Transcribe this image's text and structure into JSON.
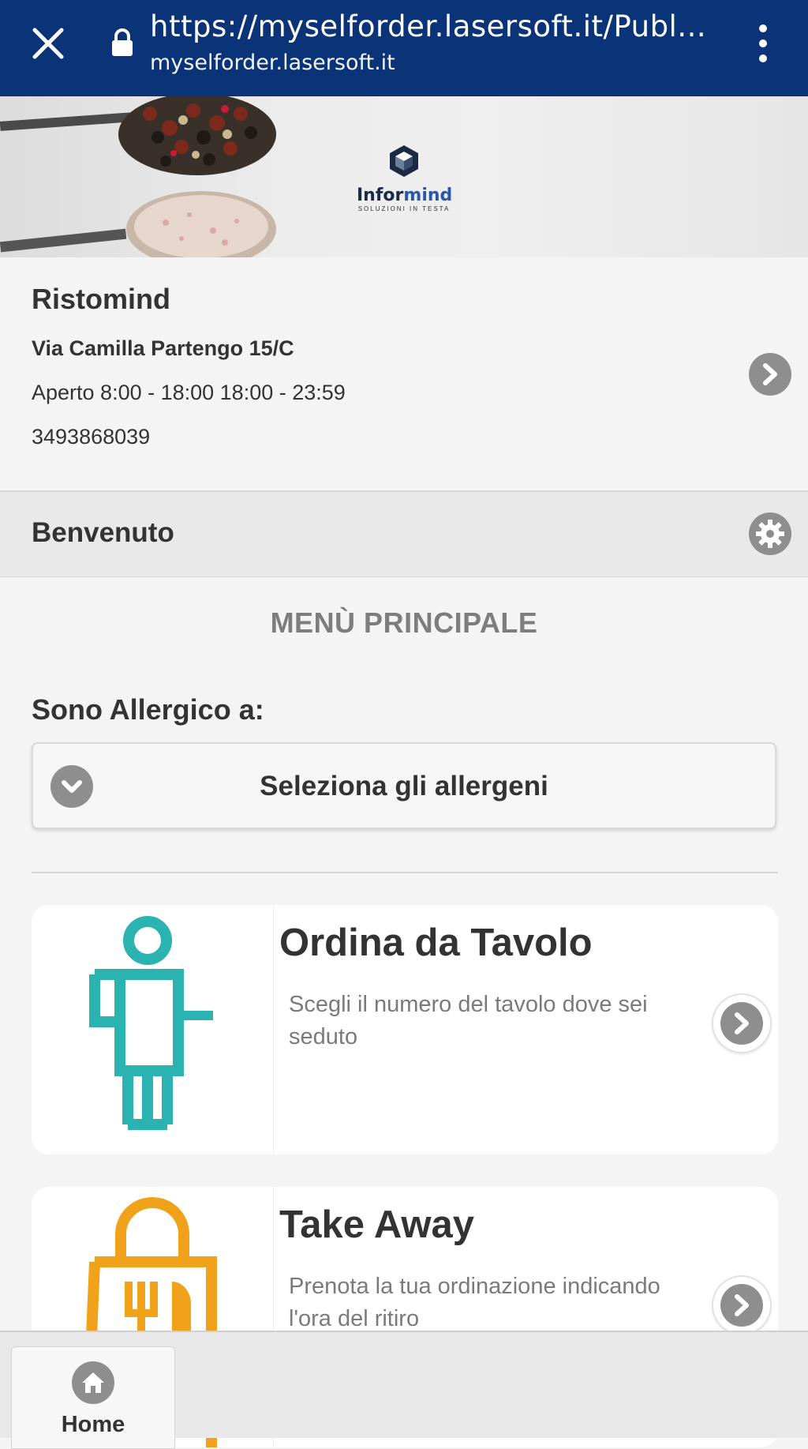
{
  "browser": {
    "url": "https://myselforder.lasersoft.it/Publ...",
    "domain": "myselforder.lasersoft.it"
  },
  "banner": {
    "logo_prefix": "Infor",
    "logo_suffix": "mind",
    "logo_tagline": "SOLUZIONI IN TESTA"
  },
  "restaurant": {
    "name": "Ristomind",
    "address": "Via Camilla Partengo 15/C",
    "hours": "Aperto 8:00 - 18:00 18:00 - 23:59",
    "phone": "3493868039"
  },
  "welcome": {
    "title": "Benvenuto"
  },
  "main": {
    "title": "MENÙ PRINCIPALE",
    "allergy_label": "Sono Allergico a:",
    "allergy_select": "Seleziona gli allergeni"
  },
  "cards": [
    {
      "title": "Ordina da Tavolo",
      "description": "Scegli il numero del tavolo dove sei seduto",
      "icon": "waiter-icon",
      "color": "#2ab3b1"
    },
    {
      "title": "Take Away",
      "description": "Prenota la tua ordinazione indicando l'ora del ritiro",
      "icon": "shopping-bag-icon",
      "color": "#f0a21a"
    }
  ],
  "bottom_nav": {
    "home_label": "Home"
  },
  "colors": {
    "browser_bar": "#0b3478",
    "button_grey": "#8e8e8e"
  }
}
